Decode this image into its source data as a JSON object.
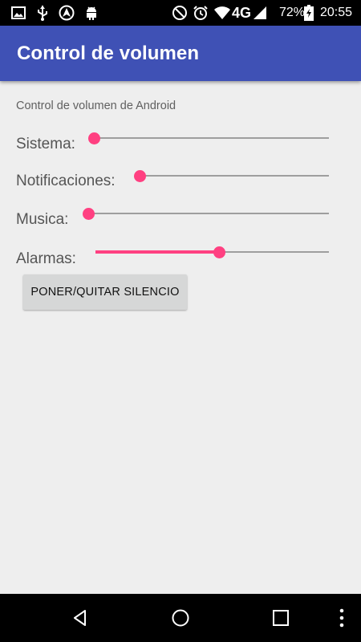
{
  "status_bar": {
    "battery": "72%",
    "network": "4G",
    "time": "20:55",
    "icons": [
      "image-icon",
      "usb-icon",
      "android-auto-icon",
      "android-debug-icon",
      "do-not-disturb-icon",
      "alarm-icon",
      "wifi-icon",
      "signal-icon",
      "battery-charging-icon"
    ]
  },
  "app_bar": {
    "title": "Control de volumen"
  },
  "main": {
    "subtitle": "Control de volumen de Android",
    "sliders": [
      {
        "label": "Sistema:",
        "value_fraction": 0.0
      },
      {
        "label": "Notificaciones:",
        "value_fraction": 0.0
      },
      {
        "label": "Musica:",
        "value_fraction": 0.0
      },
      {
        "label": "Alarmas:",
        "value_fraction": 0.53
      }
    ],
    "mute_button_label": "PONER/QUITAR SILENCIO"
  },
  "nav_bar": {
    "icons": [
      "back-icon",
      "home-icon",
      "recents-icon",
      "more-options-icon"
    ]
  },
  "colors": {
    "primary": "#3f51b5",
    "accent": "#ff4081",
    "status_bar": "#000000",
    "background": "#eeeeee"
  }
}
